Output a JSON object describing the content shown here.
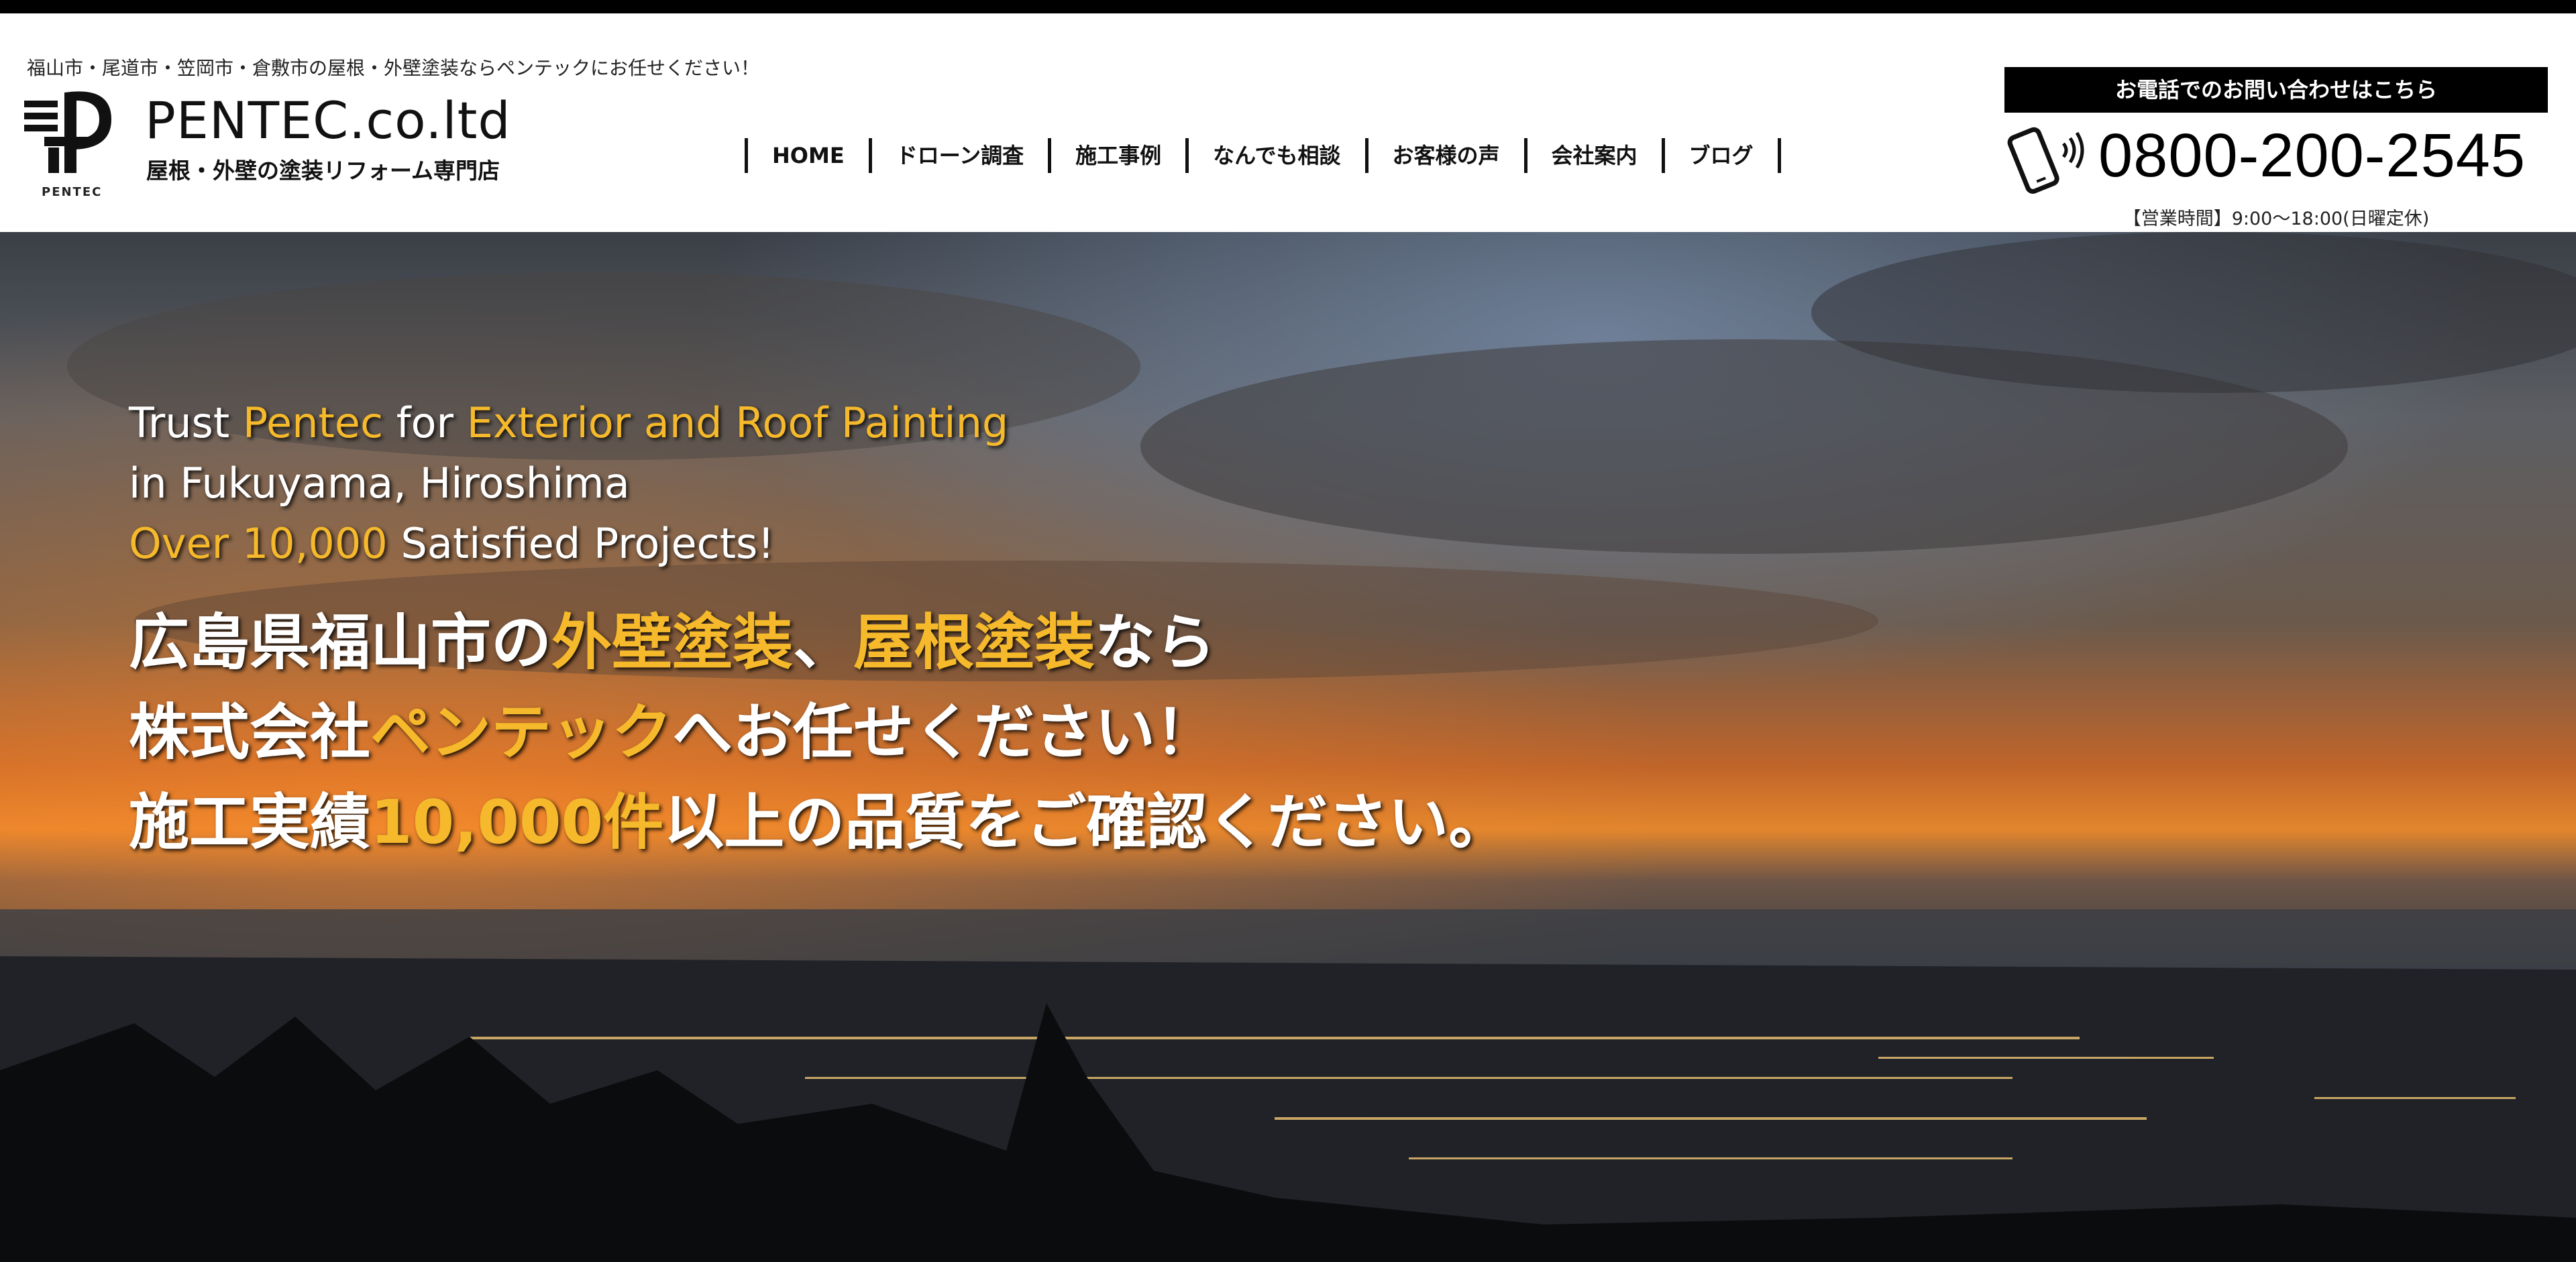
{
  "header": {
    "tagline": "福山市・尾道市・笠岡市・倉敷市の屋根・外壁塗装ならペンテックにお任せください！",
    "logo_caption": "PENTEC",
    "brand_name": "PENTEC.co.ltd",
    "brand_sub": "屋根・外壁の塗装リフォーム専門店"
  },
  "nav": {
    "items": [
      {
        "label": "HOME"
      },
      {
        "label": "ドローン調査"
      },
      {
        "label": "施工事例"
      },
      {
        "label": "なんでも相談"
      },
      {
        "label": "お客様の声"
      },
      {
        "label": "会社案内"
      },
      {
        "label": "ブログ"
      }
    ]
  },
  "contact": {
    "banner": "お電話でのお問い合わせはこちら",
    "phone": "0800-200-2545",
    "hours": "【営業時間】9:00〜18:00(日曜定休)",
    "icon": "smartphone-icon"
  },
  "hero": {
    "en_line1": {
      "a": "Trust ",
      "b": "Pentec",
      "c": " for ",
      "d": "Exterior and Roof Painting"
    },
    "en_line2": "in Fukuyama, Hiroshima",
    "en_line3": {
      "a": "Over 10,000",
      "b": " Satisfied Projects!"
    },
    "jp_line1": {
      "a": "広島県福山市の",
      "b": "外壁塗装",
      "c": "、",
      "d": "屋根塗装",
      "e": "なら"
    },
    "jp_line2": {
      "a": "株式会社",
      "b": "ペンテック",
      "c": "へお任せください！"
    },
    "jp_line3": {
      "a": "施工実績",
      "b": "10,000件",
      "c": "以上の品質をご確認ください。"
    }
  },
  "colors": {
    "accent_gold": "#f5b92b",
    "header_bg": "#ffffff",
    "banner_bg": "#000000"
  }
}
